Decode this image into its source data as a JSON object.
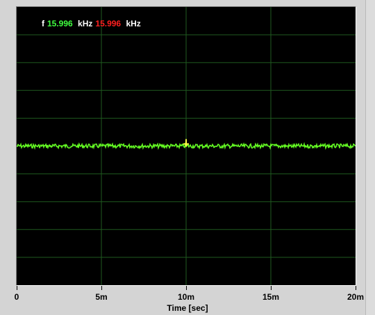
{
  "readout": {
    "prefix": "f",
    "value_green": "15.996",
    "unit_1": "kHz",
    "value_red": "15.996",
    "unit_2": "kHz"
  },
  "colors": {
    "plot_background": "#000000",
    "grid": "#1f5a1f",
    "trace": "#66ff22",
    "cursor": "#ffff44",
    "readout_green": "#40ff40",
    "readout_red": "#ff2020"
  },
  "chart_data": {
    "type": "line",
    "title": "",
    "xlabel": "Time [sec]",
    "ylabel": "",
    "x_tick_labels": [
      "0",
      "5m",
      "10m",
      "15m",
      "20m"
    ],
    "x_ticks": [
      0,
      0.005,
      0.01,
      0.015,
      0.02
    ],
    "xlim": [
      0,
      0.02
    ],
    "grid": true,
    "grid_divisions_x": 4,
    "grid_divisions_y": 10,
    "series": [
      {
        "x": [
          0,
          0.02
        ],
        "y": [
          15.996,
          15.996
        ]
      }
    ],
    "cursor_x": 0.01
  }
}
